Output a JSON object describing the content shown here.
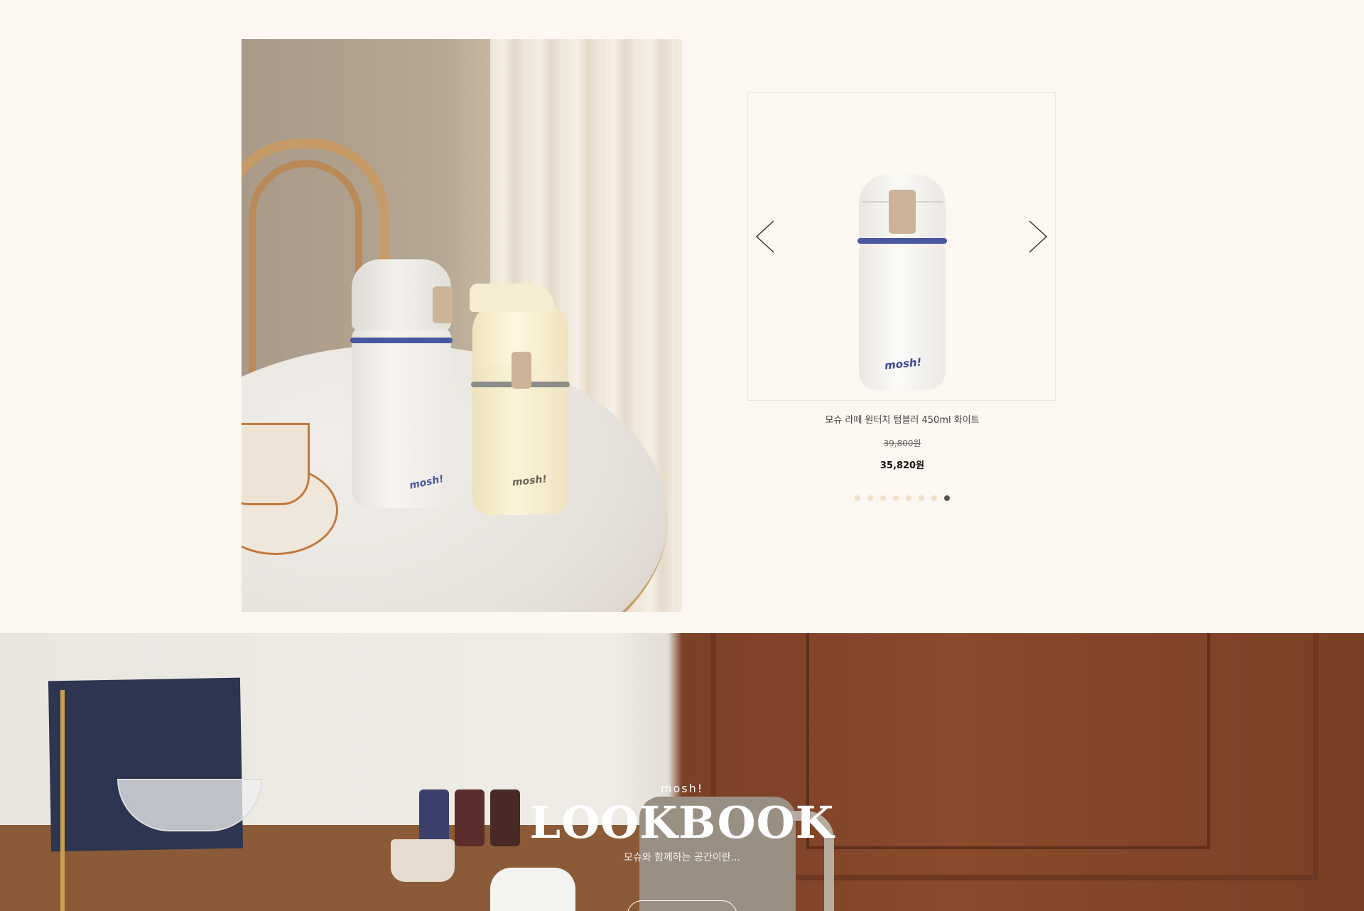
{
  "colors": {
    "background": "#fcf7f0",
    "band_blue": "#4b56a0",
    "dot_inactive": "#f3dfc6",
    "dot_active": "#555555"
  },
  "lifestyle_photo": {
    "bottle_logo_left": "mosh!",
    "bottle_logo_right": "mosh!"
  },
  "slider": {
    "prev_icon": "chevron-left-icon",
    "next_icon": "chevron-right-icon",
    "product": {
      "logo": "mosh!",
      "name": "모슈 라떼 원터치 텀블러 450ml 화이트",
      "price_original": "39,800원",
      "price_sale": "35,820원"
    },
    "dots_total": 8,
    "active_dot": 8
  },
  "lookbook": {
    "brand": "mosh!",
    "title": "LOOKBOOK",
    "subtitle": "모슈와 함께하는 공간이란..."
  }
}
